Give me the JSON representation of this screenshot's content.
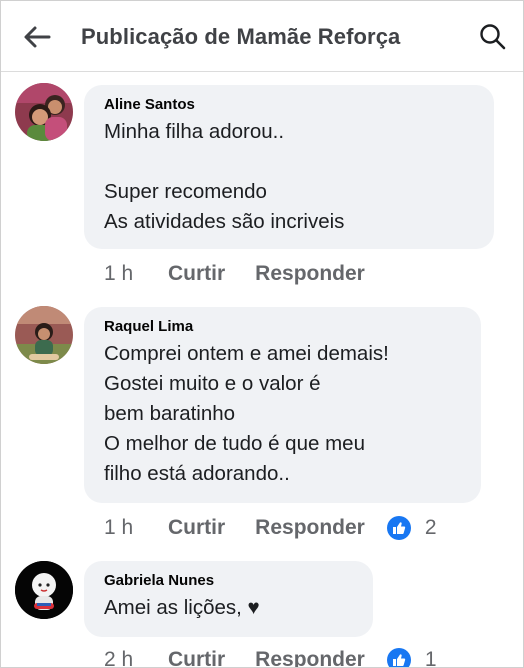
{
  "header": {
    "title": "Publicação de Mamãe Reforça"
  },
  "comments": [
    {
      "author": "Aline Santos",
      "text": "Minha filha adorou..\n\nSuper recomendo\nAs atividades são incriveis",
      "time": "1 h",
      "like_label": "Curtir",
      "reply_label": "Responder"
    },
    {
      "author": "Raquel Lima",
      "text": "Comprei ontem e amei demais!\nGostei muito e o valor é\nbem baratinho\nO melhor de tudo é que meu\nfilho está adorando..",
      "time": "1 h",
      "like_label": "Curtir",
      "reply_label": "Responder",
      "reactions": "2"
    },
    {
      "author": "Gabriela Nunes",
      "text": "Amei as lições, ♥",
      "time": "2 h",
      "like_label": "Curtir",
      "reply_label": "Responder",
      "reactions": "1"
    }
  ],
  "colors": {
    "bubble": "#f0f2f5",
    "accent": "#1877f2",
    "meta": "#65676b"
  },
  "icons": [
    "back-arrow-icon",
    "search-icon",
    "like-reaction-icon"
  ]
}
